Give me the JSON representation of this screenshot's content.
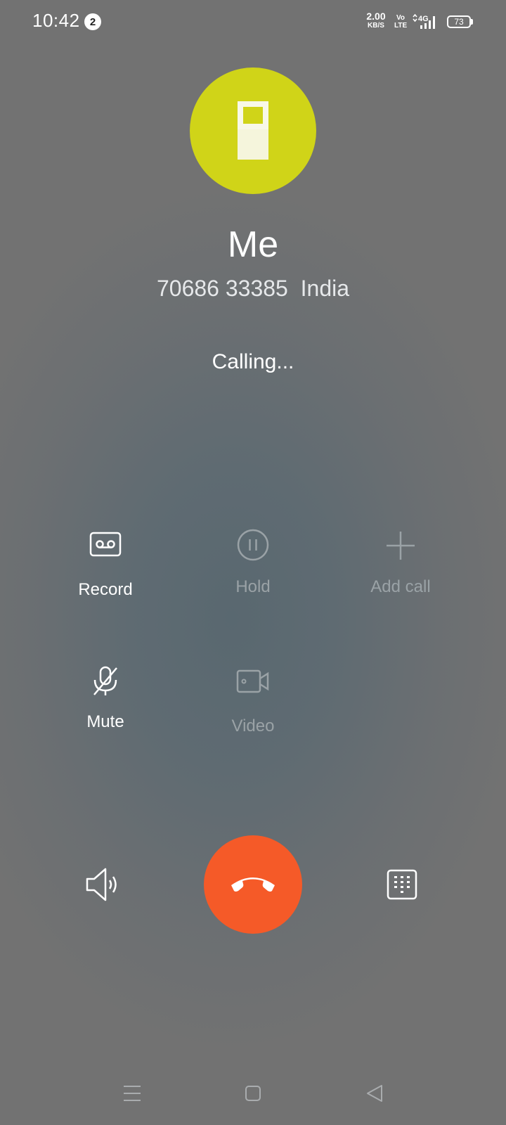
{
  "status_bar": {
    "time": "10:42",
    "notification_count": "2",
    "net_speed_value": "2.00",
    "net_speed_unit": "KB/S",
    "volte_top": "Vo",
    "volte_bottom": "LTE",
    "network_type": "4G",
    "battery_level": "73"
  },
  "contact": {
    "name": "Me",
    "number": "70686 33385  India",
    "avatar_color": "#d0d418"
  },
  "call": {
    "status": "Calling..."
  },
  "controls": [
    {
      "label": "Record",
      "icon": "record-icon",
      "enabled": true
    },
    {
      "label": "Hold",
      "icon": "pause-icon",
      "enabled": false
    },
    {
      "label": "Add call",
      "icon": "plus-icon",
      "enabled": false
    },
    {
      "label": "Mute",
      "icon": "mic-off-icon",
      "enabled": true
    },
    {
      "label": "Video",
      "icon": "video-icon",
      "enabled": false
    }
  ],
  "actions": {
    "speaker_icon": "speaker-icon",
    "end_call_icon": "phone-hangup-icon",
    "end_call_color": "#f55a28",
    "dialpad_icon": "dialpad-icon"
  },
  "nav": {
    "menu_icon": "menu-icon",
    "home_icon": "home-icon",
    "back_icon": "back-icon"
  }
}
